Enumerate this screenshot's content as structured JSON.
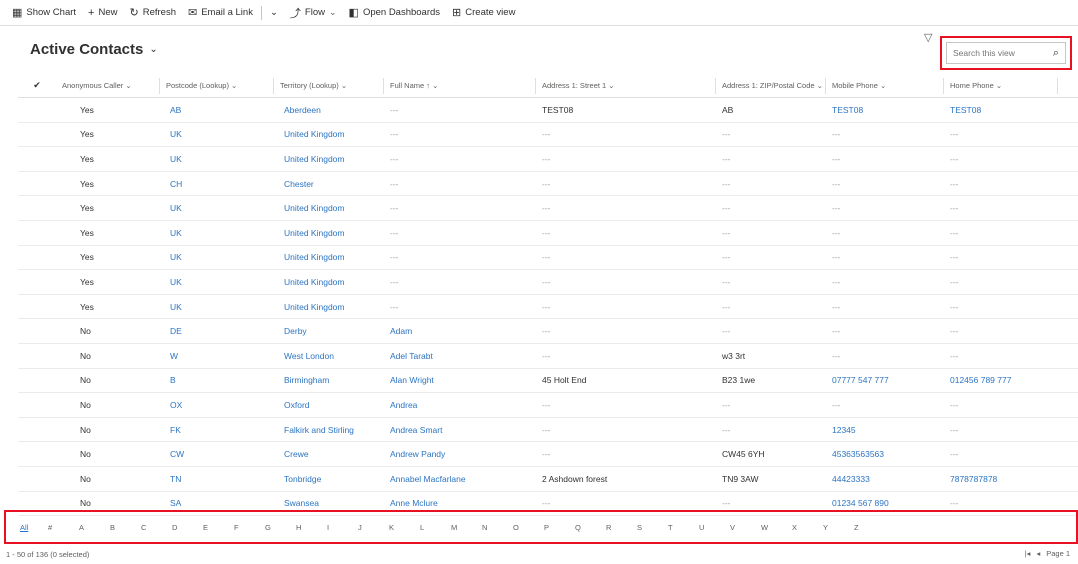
{
  "commandbar": {
    "items": [
      {
        "label": "Show Chart",
        "icon": "chart-icon",
        "glyph": "▦"
      },
      {
        "label": "New",
        "icon": "plus-icon",
        "glyph": "+"
      },
      {
        "label": "Refresh",
        "icon": "refresh-icon",
        "glyph": "↻"
      },
      {
        "label": "Email a Link",
        "icon": "email-link-icon",
        "glyph": "✉"
      },
      {
        "label": "Flow",
        "icon": "flow-icon",
        "glyph": "⤴"
      },
      {
        "label": "Open Dashboards",
        "icon": "dashboard-icon",
        "glyph": "◧"
      },
      {
        "label": "Create view",
        "icon": "create-view-icon",
        "glyph": "⊞"
      }
    ]
  },
  "view": {
    "title": "Active Contacts",
    "search_placeholder": "Search this view"
  },
  "grid": {
    "headers": {
      "anon": "Anonymous Caller",
      "post": "Postcode (Lookup)",
      "terr": "Territory (Lookup)",
      "full": "Full Name",
      "addr": "Address 1: Street 1",
      "zip": "Address 1: ZIP/Postal Code",
      "mob": "Mobile Phone",
      "home": "Home Phone"
    },
    "rows": [
      {
        "anon": "Yes",
        "post": "AB",
        "terr": "Aberdeen",
        "full": "---",
        "addr": "TEST08",
        "zip": "AB",
        "mob": "TEST08",
        "home": "TEST08"
      },
      {
        "anon": "Yes",
        "post": "UK",
        "terr": "United Kingdom",
        "full": "---",
        "addr": "---",
        "zip": "---",
        "mob": "---",
        "home": "---"
      },
      {
        "anon": "Yes",
        "post": "UK",
        "terr": "United Kingdom",
        "full": "---",
        "addr": "---",
        "zip": "---",
        "mob": "---",
        "home": "---"
      },
      {
        "anon": "Yes",
        "post": "CH",
        "terr": "Chester",
        "full": "---",
        "addr": "---",
        "zip": "---",
        "mob": "---",
        "home": "---"
      },
      {
        "anon": "Yes",
        "post": "UK",
        "terr": "United Kingdom",
        "full": "---",
        "addr": "---",
        "zip": "---",
        "mob": "---",
        "home": "---"
      },
      {
        "anon": "Yes",
        "post": "UK",
        "terr": "United Kingdom",
        "full": "---",
        "addr": "---",
        "zip": "---",
        "mob": "---",
        "home": "---"
      },
      {
        "anon": "Yes",
        "post": "UK",
        "terr": "United Kingdom",
        "full": "---",
        "addr": "---",
        "zip": "---",
        "mob": "---",
        "home": "---"
      },
      {
        "anon": "Yes",
        "post": "UK",
        "terr": "United Kingdom",
        "full": "---",
        "addr": "---",
        "zip": "---",
        "mob": "---",
        "home": "---"
      },
      {
        "anon": "Yes",
        "post": "UK",
        "terr": "United Kingdom",
        "full": "---",
        "addr": "---",
        "zip": "---",
        "mob": "---",
        "home": "---"
      },
      {
        "anon": "No",
        "post": "DE",
        "terr": "Derby",
        "full": "Adam",
        "addr": "---",
        "zip": "---",
        "mob": "---",
        "home": "---"
      },
      {
        "anon": "No",
        "post": "W",
        "terr": "West London",
        "full": "Adel Tarabt",
        "addr": "---",
        "zip": "w3 3rt",
        "mob": "---",
        "home": "---"
      },
      {
        "anon": "No",
        "post": "B",
        "terr": "Birmingham",
        "full": "Alan Wright",
        "addr": "45 Holt End",
        "zip": "B23 1we",
        "mob": "07777 547 777",
        "home": "012456 789 777"
      },
      {
        "anon": "No",
        "post": "OX",
        "terr": "Oxford",
        "full": "Andrea",
        "addr": "---",
        "zip": "---",
        "mob": "---",
        "home": "---"
      },
      {
        "anon": "No",
        "post": "FK",
        "terr": "Falkirk and Stirling",
        "full": "Andrea Smart",
        "addr": "---",
        "zip": "---",
        "mob": "12345",
        "home": "---"
      },
      {
        "anon": "No",
        "post": "CW",
        "terr": "Crewe",
        "full": "Andrew Pandy",
        "addr": "---",
        "zip": "CW45 6YH",
        "mob": "45363563563",
        "home": "---"
      },
      {
        "anon": "No",
        "post": "TN",
        "terr": "Tonbridge",
        "full": "Annabel Macfarlane",
        "addr": "2 Ashdown forest",
        "zip": "TN9 3AW",
        "mob": "44423333",
        "home": "7878787878"
      },
      {
        "anon": "No",
        "post": "SA",
        "terr": "Swansea",
        "full": "Anne Mclure",
        "addr": "---",
        "zip": "---",
        "mob": "01234 567 890",
        "home": "---"
      }
    ]
  },
  "jumpbar": {
    "letters": [
      "All",
      "#",
      "A",
      "B",
      "C",
      "D",
      "E",
      "F",
      "G",
      "H",
      "I",
      "J",
      "K",
      "L",
      "M",
      "N",
      "O",
      "P",
      "Q",
      "R",
      "S",
      "T",
      "U",
      "V",
      "W",
      "X",
      "Y",
      "Z"
    ]
  },
  "footer": {
    "status": "1 - 50 of 136 (0 selected)",
    "page_label": "Page 1"
  },
  "colors": {
    "link": "#2b74c2",
    "highlight": "#e81123"
  }
}
